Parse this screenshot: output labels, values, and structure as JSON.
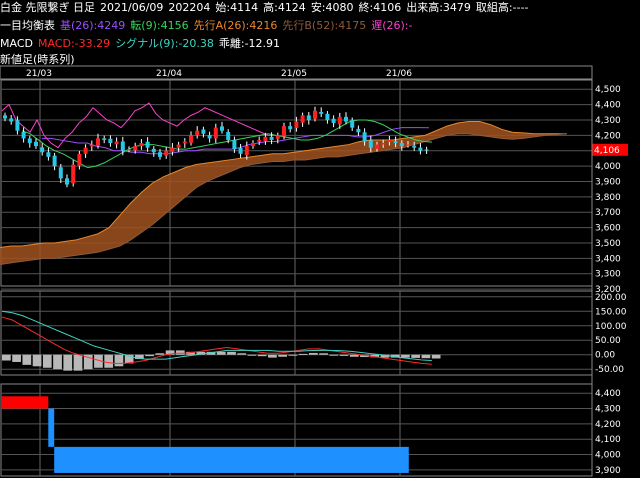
{
  "header": {
    "instrument": "白金 先限繋ぎ 日足",
    "date": "2021/06/09",
    "volume": "202204",
    "open": "始:4114",
    "high": "高:4124",
    "low": "安:4080",
    "close": "終:4106",
    "turnover": "出来高:3479",
    "open_interest": "取組高:----"
  },
  "ichimoku": {
    "title": "一目均衡表",
    "kijun": "基(26):4249",
    "tenkan": "転(9):4156",
    "senkou_a": "先行A(26):4216",
    "senkou_b": "先行B(52):4175",
    "chikou": "遅(26):-",
    "colors": {
      "kijun": "#9b4dff",
      "tenkan": "#36d45a",
      "senkou_a": "#e8862c",
      "senkou_b": "#8e5a3a",
      "chikou": "#ff3fd0",
      "cloud": "#a0521e"
    }
  },
  "macd_legend": {
    "title": "MACD",
    "macd": "MACD:-33.29",
    "signal": "シグナル(9):-20.38",
    "deviation": "乖離:-12.91",
    "colors": {
      "macd": "#ff2a2a",
      "signal": "#3fd6c4"
    }
  },
  "bottom_title": "新値足(時系列)",
  "months": [
    "21/03",
    "21/04",
    "21/05",
    "21/06"
  ],
  "price_axis": [
    "4,500",
    "4,400",
    "4,300",
    "4,200",
    "4,100",
    "4,000",
    "3,900",
    "3,800",
    "3,700",
    "3,600",
    "3,500",
    "3,400",
    "3,300",
    "3,200"
  ],
  "last_price_label": "4,106",
  "macd_axis": [
    "200.00",
    "150.00",
    "100.00",
    "50.00",
    "0.00",
    "-50.00"
  ],
  "bottom_axis": [
    "4,400",
    "4,300",
    "4,200",
    "4,100",
    "4,000",
    "3,900"
  ],
  "chart_data": [
    {
      "type": "candlestick",
      "title": "白金 先限繋ぎ 日足",
      "ylim": [
        3220,
        4560
      ],
      "ohlc_summary": {
        "open": 4114,
        "high": 4124,
        "low": 4080,
        "close": 4106
      },
      "closes": [
        4310,
        4290,
        4230,
        4180,
        4150,
        4130,
        4090,
        4060,
        4000,
        3920,
        3880,
        4010,
        4080,
        4120,
        4140,
        4180,
        4170,
        4150,
        4160,
        4100,
        4110,
        4130,
        4150,
        4120,
        4090,
        4060,
        4100,
        4120,
        4140,
        4160,
        4200,
        4230,
        4210,
        4180,
        4250,
        4230,
        4170,
        4110,
        4080,
        4130,
        4150,
        4170,
        4190,
        4170,
        4200,
        4260,
        4240,
        4290,
        4330,
        4300,
        4360,
        4340,
        4300,
        4280,
        4320,
        4290,
        4250,
        4220,
        4160,
        4120,
        4140,
        4150,
        4170,
        4150,
        4130,
        4140,
        4120,
        4100,
        4106
      ],
      "kijun": [
        4180,
        4180,
        4170,
        4160,
        4150,
        4150,
        4130,
        4120,
        4100,
        4100,
        4090,
        4090,
        4080,
        4080,
        4080,
        4090,
        4100,
        4100,
        4110,
        4110,
        4110,
        4110,
        4120,
        4140,
        4150,
        4160,
        4160,
        4170,
        4180,
        4190,
        4200,
        4200,
        4200,
        4200,
        4200,
        4190,
        4190,
        4200,
        4220,
        4240,
        4250,
        4250,
        4250,
        4249
      ],
      "tenkan": [
        4230,
        4210,
        4170,
        4130,
        4100,
        4080,
        4050,
        4020,
        3990,
        4000,
        4020,
        4050,
        4080,
        4110,
        4130,
        4140,
        4140,
        4130,
        4120,
        4110,
        4110,
        4120,
        4130,
        4140,
        4150,
        4160,
        4170,
        4180,
        4190,
        4200,
        4210,
        4200,
        4190,
        4180,
        4170,
        4170,
        4180,
        4200,
        4230,
        4260,
        4290,
        4300,
        4300,
        4290,
        4270,
        4240,
        4210,
        4190,
        4170,
        4160,
        4156
      ],
      "senkou_a": [
        3470,
        3480,
        3480,
        3490,
        3500,
        3500,
        3510,
        3520,
        3540,
        3560,
        3600,
        3680,
        3760,
        3830,
        3890,
        3930,
        3960,
        3990,
        4010,
        4020,
        4030,
        4040,
        4050,
        4060,
        4070,
        4080,
        4080,
        4090,
        4100,
        4110,
        4120,
        4130,
        4140,
        4160,
        4170,
        4170,
        4170,
        4180,
        4190,
        4200,
        4230,
        4260,
        4280,
        4290,
        4290,
        4270,
        4240,
        4220,
        4216,
        4210,
        4210,
        4210,
        4210
      ],
      "senkou_b": [
        3360,
        3370,
        3380,
        3390,
        3400,
        3400,
        3410,
        3420,
        3430,
        3440,
        3460,
        3480,
        3520,
        3570,
        3620,
        3680,
        3740,
        3800,
        3860,
        3900,
        3930,
        3960,
        3990,
        4010,
        4020,
        4030,
        4030,
        4040,
        4040,
        4050,
        4060,
        4060,
        4070,
        4080,
        4090,
        4100,
        4110,
        4120,
        4140,
        4160,
        4180,
        4200,
        4210,
        4210,
        4200,
        4190,
        4180,
        4175,
        4180,
        4190,
        4200,
        4205,
        4210
      ],
      "chikou": [
        4360,
        4400,
        4300,
        4260,
        4220,
        4300,
        4200,
        4150,
        4120,
        4180,
        4220,
        4280,
        4320,
        4380,
        4340,
        4300,
        4280,
        4250,
        4300,
        4360,
        4380,
        4410,
        4340,
        4300,
        4280,
        4260,
        4300,
        4330,
        4350,
        4380,
        4360,
        4340,
        4320,
        4300,
        4280,
        4260,
        4240,
        4220,
        4200,
        4200
      ],
      "x_months": [
        "21/03",
        "21/04",
        "21/05",
        "21/06"
      ]
    },
    {
      "type": "line",
      "title": "MACD",
      "ylim": [
        -70,
        220
      ],
      "series": [
        {
          "name": "MACD",
          "values": [
            130,
            120,
            100,
            80,
            60,
            40,
            20,
            5,
            -5,
            -15,
            -25,
            -30,
            -30,
            -25,
            -20,
            -10,
            0,
            5,
            5,
            10,
            15,
            20,
            25,
            20,
            15,
            10,
            5,
            5,
            10,
            15,
            20,
            20,
            15,
            10,
            5,
            0,
            -5,
            -10,
            -15,
            -20,
            -25,
            -30,
            -33
          ]
        },
        {
          "name": "シグナル(9)",
          "values": [
            150,
            145,
            135,
            120,
            105,
            90,
            75,
            60,
            45,
            30,
            20,
            10,
            0,
            -10,
            -15,
            -15,
            -15,
            -10,
            -5,
            0,
            5,
            10,
            15,
            15,
            15,
            15,
            15,
            12,
            12,
            12,
            14,
            15,
            15,
            14,
            12,
            8,
            4,
            0,
            -5,
            -10,
            -14,
            -18,
            -20
          ]
        }
      ],
      "deviation": [
        -20,
        -25,
        -35,
        -40,
        -45,
        -50,
        -55,
        -55,
        -50,
        -45,
        -45,
        -40,
        -30,
        -15,
        -5,
        5,
        15,
        15,
        10,
        10,
        10,
        10,
        10,
        5,
        0,
        -5,
        -10,
        -7,
        -2,
        3,
        6,
        5,
        0,
        -4,
        -7,
        -8,
        -9,
        -10,
        -10,
        -10,
        -11,
        -12,
        -13
      ]
    },
    {
      "type": "bar",
      "title": "新値足(時系列)",
      "ylim": [
        3860,
        4460
      ],
      "segments": [
        {
          "from": 0,
          "to": 0.08,
          "low": 4300,
          "high": 4380,
          "color": "#ff0000"
        },
        {
          "from": 0.08,
          "to": 0.09,
          "low": 4050,
          "high": 4300,
          "color": "#1e90ff"
        },
        {
          "from": 0.09,
          "to": 0.69,
          "low": 3880,
          "high": 4050,
          "color": "#1e90ff"
        }
      ]
    }
  ]
}
